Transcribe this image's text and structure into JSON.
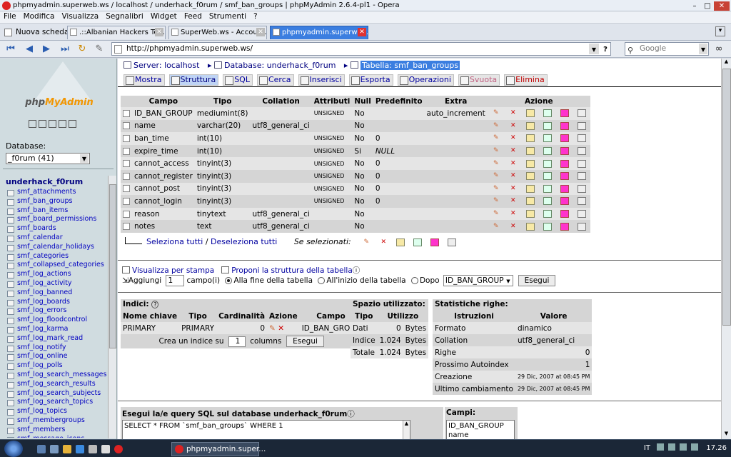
{
  "window": {
    "title": "phpmyadmin.superweb.ws / localhost / underhack_f0rum / smf_ban_groups | phpMyAdmin 2.6.4-pl1 - Opera"
  },
  "menu": [
    "File",
    "Modifica",
    "Visualizza",
    "Segnalibri",
    "Widget",
    "Feed",
    "Strumenti",
    "?"
  ],
  "tabs": {
    "new_tab": "Nuova scheda",
    "items": [
      {
        "label": ".::Albanian Hackers Tea...",
        "active": false
      },
      {
        "label": "SuperWeb.ws - Accoun...",
        "active": false
      },
      {
        "label": "phpmyadmin.superwe...",
        "active": true
      }
    ]
  },
  "nav": {
    "address": "http://phpmyadmin.superweb.ws/",
    "search_placeholder": "Google",
    "help": "?"
  },
  "sidebar": {
    "logo": {
      "php": "php",
      "myadmin": "MyAdmin"
    },
    "db_label": "Database:",
    "db_selected": "_f0rum (41)",
    "db_name": "underhack_f0rum",
    "tables": [
      "smf_attachments",
      "smf_ban_groups",
      "smf_ban_items",
      "smf_board_permissions",
      "smf_boards",
      "smf_calendar",
      "smf_calendar_holidays",
      "smf_categories",
      "smf_collapsed_categories",
      "smf_log_actions",
      "smf_log_activity",
      "smf_log_banned",
      "smf_log_boards",
      "smf_log_errors",
      "smf_log_floodcontrol",
      "smf_log_karma",
      "smf_log_mark_read",
      "smf_log_notify",
      "smf_log_online",
      "smf_log_polls",
      "smf_log_search_messages",
      "smf_log_search_results",
      "smf_log_search_subjects",
      "smf_log_search_topics",
      "smf_log_topics",
      "smf_membergroups",
      "smf_members",
      "smf_message_icons"
    ]
  },
  "breadcrumb": {
    "server": "Server: localhost",
    "database": "Database: underhack_f0rum",
    "table": "Tabella: smf_ban_groups"
  },
  "top_tabs": [
    {
      "label": "Mostra",
      "state": "normal"
    },
    {
      "label": "Struttura",
      "state": "active"
    },
    {
      "label": "SQL",
      "state": "normal"
    },
    {
      "label": "Cerca",
      "state": "normal"
    },
    {
      "label": "Inserisci",
      "state": "normal"
    },
    {
      "label": "Esporta",
      "state": "normal"
    },
    {
      "label": "Operazioni",
      "state": "normal"
    },
    {
      "label": "Svuota",
      "state": "disabled"
    },
    {
      "label": "Elimina",
      "state": "danger"
    }
  ],
  "fields_table": {
    "headers": [
      "Campo",
      "Tipo",
      "Collation",
      "Attributi",
      "Null",
      "Predefinito",
      "Extra",
      "Azione"
    ],
    "rows": [
      {
        "campo": "ID_BAN_GROUP",
        "tipo": "mediumint(8)",
        "collation": "",
        "attributi": "UNSIGNED",
        "null": "No",
        "predefinito": "",
        "extra": "auto_increment"
      },
      {
        "campo": "name",
        "tipo": "varchar(20)",
        "collation": "utf8_general_ci",
        "attributi": "",
        "null": "No",
        "predefinito": "",
        "extra": ""
      },
      {
        "campo": "ban_time",
        "tipo": "int(10)",
        "collation": "",
        "attributi": "UNSIGNED",
        "null": "No",
        "predefinito": "0",
        "extra": ""
      },
      {
        "campo": "expire_time",
        "tipo": "int(10)",
        "collation": "",
        "attributi": "UNSIGNED",
        "null": "Si",
        "predefinito": "NULL",
        "extra": ""
      },
      {
        "campo": "cannot_access",
        "tipo": "tinyint(3)",
        "collation": "",
        "attributi": "UNSIGNED",
        "null": "No",
        "predefinito": "0",
        "extra": ""
      },
      {
        "campo": "cannot_register",
        "tipo": "tinyint(3)",
        "collation": "",
        "attributi": "UNSIGNED",
        "null": "No",
        "predefinito": "0",
        "extra": ""
      },
      {
        "campo": "cannot_post",
        "tipo": "tinyint(3)",
        "collation": "",
        "attributi": "UNSIGNED",
        "null": "No",
        "predefinito": "0",
        "extra": ""
      },
      {
        "campo": "cannot_login",
        "tipo": "tinyint(3)",
        "collation": "",
        "attributi": "UNSIGNED",
        "null": "No",
        "predefinito": "0",
        "extra": ""
      },
      {
        "campo": "reason",
        "tipo": "tinytext",
        "collation": "utf8_general_ci",
        "attributi": "",
        "null": "No",
        "predefinito": "",
        "extra": ""
      },
      {
        "campo": "notes",
        "tipo": "text",
        "collation": "utf8_general_ci",
        "attributi": "",
        "null": "No",
        "predefinito": "",
        "extra": ""
      }
    ]
  },
  "selection": {
    "select_all": "Seleziona tutti",
    "separator": "/",
    "deselect_all": "Deseleziona tutti",
    "with_selected": "Se selezionati:"
  },
  "links": {
    "print_view": "Visualizza per stampa",
    "propose": "Proponi la struttura della tabella"
  },
  "add_field": {
    "label": "Aggiungi",
    "count": "1",
    "unit": "campo(i)",
    "opt_end": "Alla fine della tabella",
    "opt_start": "All'inizio della tabella",
    "opt_after": "Dopo",
    "after_field": "ID_BAN_GROUP",
    "button": "Esegui"
  },
  "indexes": {
    "title": "Indici:",
    "help": "?",
    "headers": [
      "Nome chiave",
      "Tipo",
      "Cardinalità",
      "Azione",
      "Campo"
    ],
    "rows": [
      {
        "name": "PRIMARY",
        "type": "PRIMARY",
        "cardinality": "0",
        "field": "ID_BAN_GROUP"
      }
    ],
    "create_prefix": "Crea un indice su",
    "create_count": "1",
    "create_suffix": "columns",
    "button": "Esegui"
  },
  "space": {
    "title": "Spazio utilizzato:",
    "headers": [
      "Tipo",
      "Utilizzo"
    ],
    "rows": [
      {
        "type": "Dati",
        "value": "0",
        "unit": "Bytes"
      },
      {
        "type": "Indice",
        "value": "1.024",
        "unit": "Bytes"
      },
      {
        "type": "Totale",
        "value": "1.024",
        "unit": "Bytes"
      }
    ]
  },
  "row_stats": {
    "title": "Statistiche righe:",
    "headers": [
      "Istruzioni",
      "Valore"
    ],
    "rows": [
      {
        "label": "Formato",
        "value": "dinamico"
      },
      {
        "label": "Collation",
        "value": "utf8_general_ci"
      },
      {
        "label": "Righe",
        "value": "0"
      },
      {
        "label": "Prossimo Autoindex",
        "value": "1"
      },
      {
        "label": "Creazione",
        "value": "29 Dic, 2007 at 08:45 PM"
      },
      {
        "label": "Ultimo cambiamento",
        "value": "29 Dic, 2007 at 08:45 PM"
      }
    ]
  },
  "sql": {
    "title": "Esegui la/e query SQL sul database underhack_f0rum",
    "query": "SELECT * FROM `smf_ban_groups` WHERE 1",
    "fields_title": "Campi:",
    "fields": [
      "ID_BAN_GROUP",
      "name"
    ]
  },
  "taskbar": {
    "task": "phpmyadmin.super...",
    "lang": "IT",
    "clock": "17.26"
  }
}
